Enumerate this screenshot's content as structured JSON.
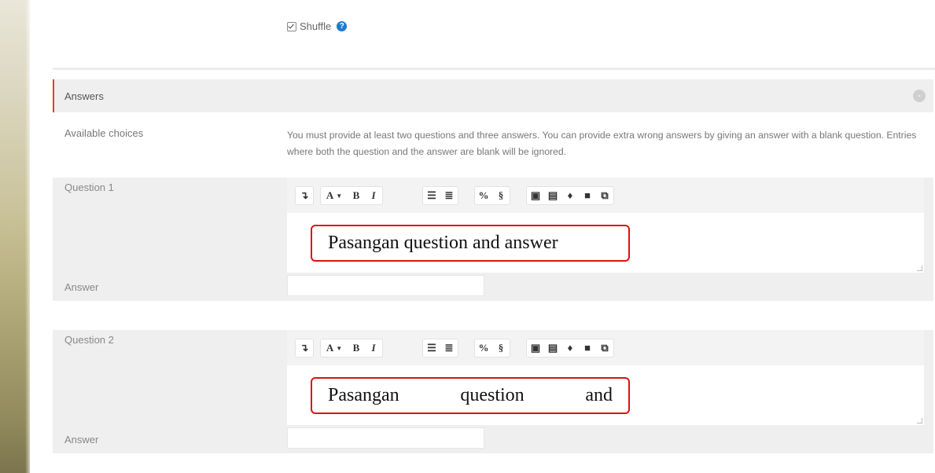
{
  "shuffle": {
    "label": "Shuffle",
    "checked": true,
    "help_icon": "question-circle-icon"
  },
  "answers_section": {
    "title": "Answers",
    "collapse_icon": "collapse-icon",
    "available_choices_label": "Available choices",
    "available_choices_text": "You must provide at least two questions and three answers. You can provide extra wrong answers by giving an answer with a blank question. Entries where both the question and the answer are blank will be ignored."
  },
  "toolbar_labels": {
    "font": "A",
    "bold": "B",
    "italic": "I"
  },
  "questions": [
    {
      "label": "Question 1",
      "callout_text": "Pasangan question and answer",
      "answer_label": "Answer",
      "answer_value": ""
    },
    {
      "label": "Question 2",
      "callout_words": [
        "Pasangan",
        "question",
        "and"
      ],
      "answer_label": "Answer",
      "answer_value": ""
    }
  ],
  "colors": {
    "accent_red": "#e01010",
    "help_blue": "#1f7acf",
    "section_bg": "#efefef"
  }
}
